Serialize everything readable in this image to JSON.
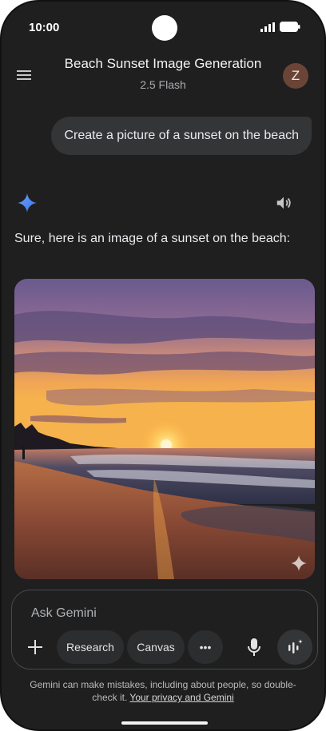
{
  "status": {
    "time": "10:00"
  },
  "header": {
    "title": "Beach Sunset Image Generation",
    "model": "2.5 Flash",
    "avatar_initial": "Z"
  },
  "user_message": "Create a picture of a sunset on the beach",
  "response": {
    "text": "Sure, here is an image of a sunset on the beach:"
  },
  "input": {
    "placeholder": "Ask Gemini",
    "chips": {
      "research": "Research",
      "canvas": "Canvas",
      "more": "•••"
    }
  },
  "disclaimer": {
    "text": "Gemini can make mistakes, including about people, so double-check it.",
    "link": "Your privacy and Gemini"
  },
  "colors": {
    "background": "#1f1f1f",
    "gemini_star": "#4c8df6",
    "bubble": "#333537"
  }
}
